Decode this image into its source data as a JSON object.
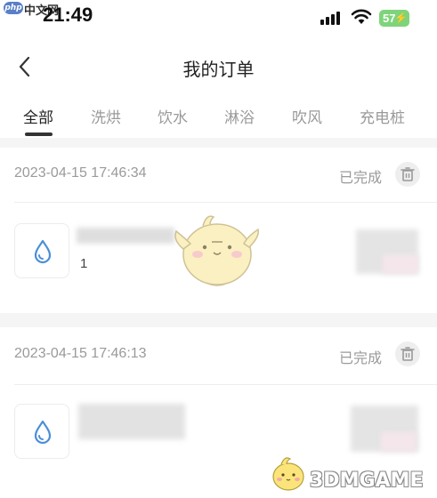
{
  "watermark_top": {
    "badge": "php",
    "text": "中文网"
  },
  "status_bar": {
    "time": "21:49",
    "battery": "57"
  },
  "header": {
    "title": "我的订单"
  },
  "tabs": [
    {
      "label": "全部",
      "active": true
    },
    {
      "label": "洗烘",
      "active": false
    },
    {
      "label": "饮水",
      "active": false
    },
    {
      "label": "淋浴",
      "active": false
    },
    {
      "label": "吹风",
      "active": false
    },
    {
      "label": "充电桩",
      "active": false
    }
  ],
  "orders": [
    {
      "date": "2023-04-15 17:46:34",
      "status": "已完成",
      "quantity": "1",
      "icon": "water-drop-icon"
    },
    {
      "date": "2023-04-15 17:46:13",
      "status": "已完成",
      "quantity": "",
      "icon": "water-drop-icon"
    }
  ],
  "watermark_bottom": {
    "text": "3DMGAME"
  },
  "colors": {
    "accent_icon": "#4a8ed8",
    "battery": "#7ed47a",
    "text_muted": "#9a9a9a"
  }
}
